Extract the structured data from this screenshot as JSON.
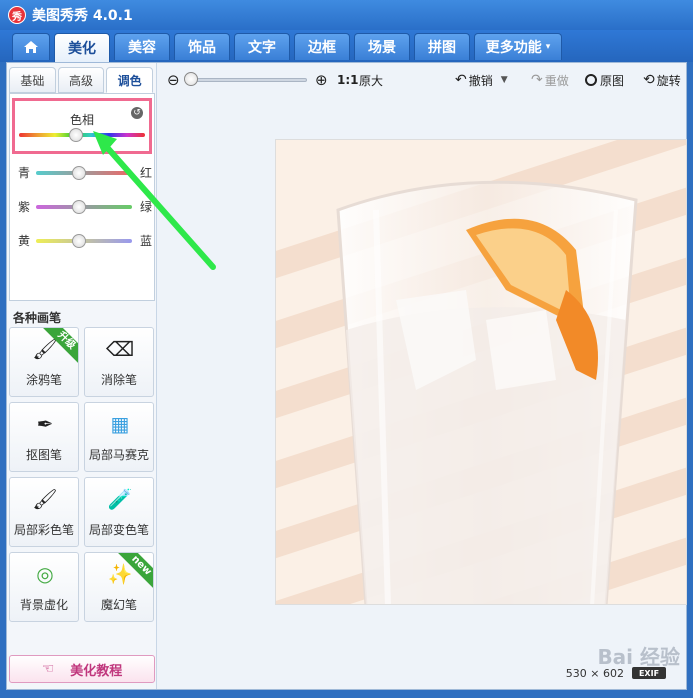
{
  "app": {
    "title": "美图秀秀 4.0.1",
    "logo_text": "秀"
  },
  "nav": {
    "home_icon": "house-icon",
    "tabs": [
      {
        "label": "美化",
        "active": true
      },
      {
        "label": "美容"
      },
      {
        "label": "饰品"
      },
      {
        "label": "文字"
      },
      {
        "label": "边框"
      },
      {
        "label": "场景"
      },
      {
        "label": "拼图"
      },
      {
        "label": "更多功能"
      }
    ],
    "more_caret": "▾"
  },
  "subtabs": [
    {
      "label": "基础"
    },
    {
      "label": "高级"
    },
    {
      "label": "调色",
      "active": true
    }
  ],
  "hue": {
    "label": "色相",
    "value_fraction": 0.45,
    "reset_symbol": "↺"
  },
  "sliders": [
    {
      "left": "青",
      "right": "红",
      "value_fraction": 0.45
    },
    {
      "left": "紫",
      "right": "绿",
      "value_fraction": 0.45
    },
    {
      "left": "黄",
      "right": "蓝",
      "value_fraction": 0.45
    }
  ],
  "brushes": {
    "title": "各种画笔",
    "tools": [
      {
        "label": "涂鸦笔",
        "icon": "🖌",
        "ribbon": "升级"
      },
      {
        "label": "消除笔",
        "icon": "⌫"
      },
      {
        "label": "抠图笔",
        "icon": "✒"
      },
      {
        "label": "局部马赛克",
        "icon": "▦"
      },
      {
        "label": "局部彩色笔",
        "icon": "🖌"
      },
      {
        "label": "局部变色笔",
        "icon": "🧪"
      },
      {
        "label": "背景虚化",
        "icon": "◎"
      },
      {
        "label": "魔幻笔",
        "icon": "✨",
        "ribbon": "new"
      }
    ]
  },
  "tutorial": {
    "label": "美化教程",
    "hand": "☜"
  },
  "toolbar": {
    "zoom_out": "⊖",
    "zoom_in": "⊕",
    "zoom_value_fraction": 0.05,
    "actual_size": "1:1",
    "original_size_label": "原大",
    "undo_label": "撤销",
    "redo_label": "重做",
    "original_label": "原图",
    "rotate_label": "旋转"
  },
  "status": {
    "size_text": "530 × 602",
    "exif_label": "EXIF",
    "watermark": "Bai 经验"
  },
  "colors": {
    "accent": "#2f78d6",
    "highlight": "#f06a90",
    "arrow": "#2ee84a"
  }
}
